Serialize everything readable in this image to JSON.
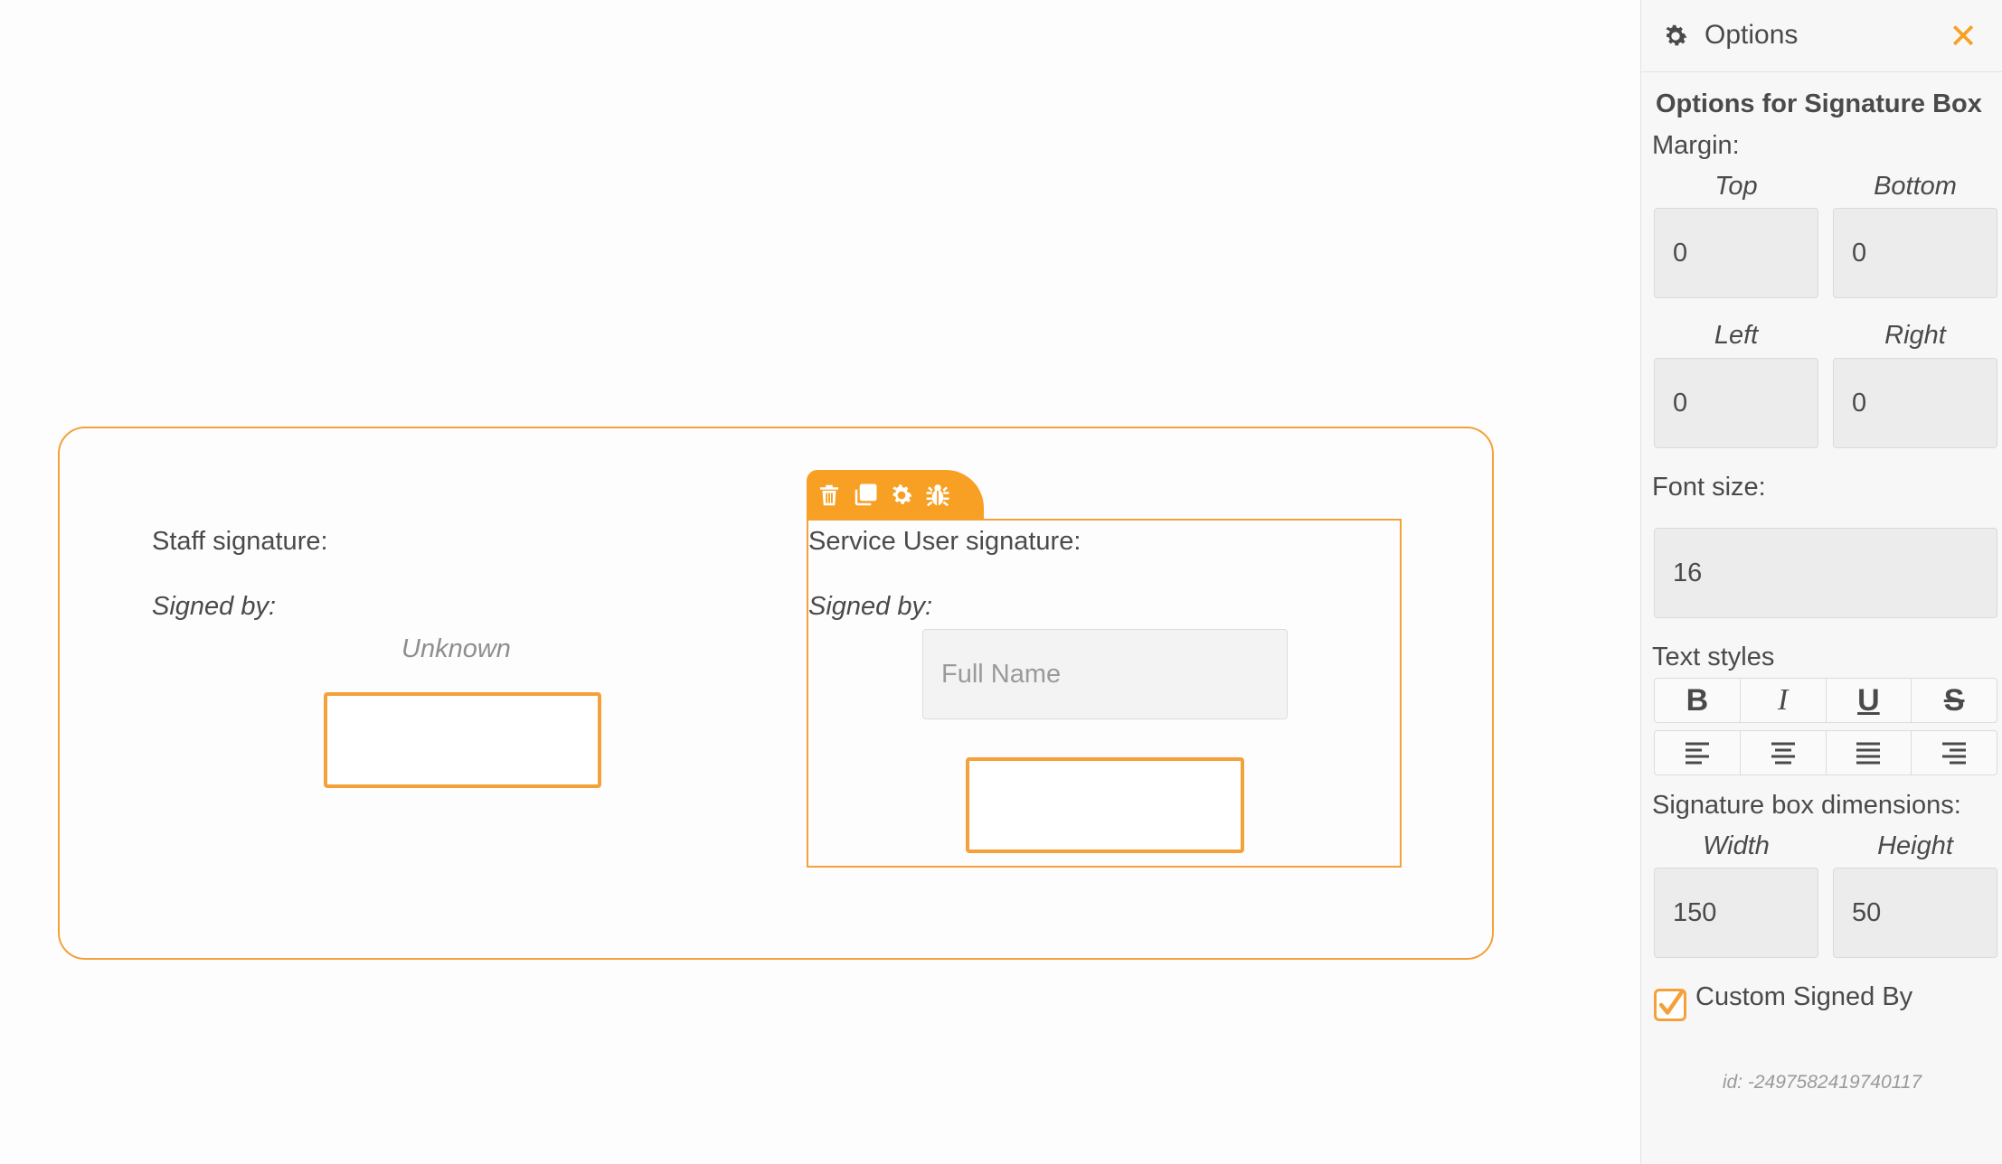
{
  "canvas": {
    "staff_label": "Staff signature:",
    "staff_signed_by": "Signed by:",
    "staff_unknown": "Unknown",
    "service_label": "Service User signature:",
    "service_signed_by": "Signed by:",
    "full_name_placeholder": "Full Name",
    "full_name_value": "",
    "toolbar_icons": [
      "trash-icon",
      "copy-icon",
      "gear-icon",
      "bug-icon"
    ]
  },
  "panel": {
    "title": "Options",
    "heading": "Options for Signature Box",
    "margin_label": "Margin:",
    "top_label": "Top",
    "bottom_label": "Bottom",
    "left_label": "Left",
    "right_label": "Right",
    "top_value": "0",
    "bottom_value": "0",
    "left_value": "0",
    "right_value": "0",
    "font_size_label": "Font size:",
    "font_size_value": "16",
    "text_styles_label": "Text styles",
    "dimensions_label": "Signature box dimensions:",
    "width_label": "Width",
    "height_label": "Height",
    "width_value": "150",
    "height_value": "50",
    "custom_signed_by_label": "Custom Signed By",
    "custom_signed_by_checked": true,
    "id_text": "id: -2497582419740117"
  },
  "colors": {
    "accent": "#f7a024",
    "text": "#4a4a4a",
    "muted": "#9a9a9a"
  }
}
